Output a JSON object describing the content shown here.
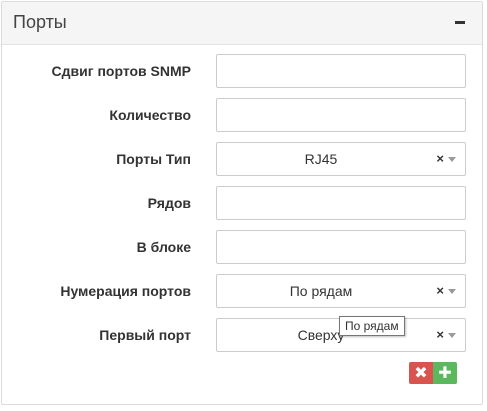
{
  "panel": {
    "title": "Порты",
    "collapse_icon": "minus-icon"
  },
  "fields": {
    "snmp_offset": {
      "label": "Сдвиг портов SNMP",
      "value": ""
    },
    "count": {
      "label": "Количество",
      "value": ""
    },
    "port_type": {
      "label": "Порты Тип",
      "value": "RJ45",
      "clear_icon": "×",
      "caret_icon": "caret-down-icon"
    },
    "rows": {
      "label": "Рядов",
      "value": ""
    },
    "in_block": {
      "label": "В блоке",
      "value": ""
    },
    "numbering": {
      "label": "Нумерация портов",
      "value": "По рядам",
      "clear_icon": "×",
      "caret_icon": "caret-down-icon"
    },
    "first_port": {
      "label": "Первый порт",
      "value": "Сверху",
      "clear_icon": "×",
      "caret_icon": "caret-down-icon"
    }
  },
  "tooltip": {
    "text": "По рядам"
  },
  "actions": {
    "remove_icon": "✖",
    "add_icon": "✚",
    "remove_color": "#d9534f",
    "add_color": "#5cb85c"
  }
}
